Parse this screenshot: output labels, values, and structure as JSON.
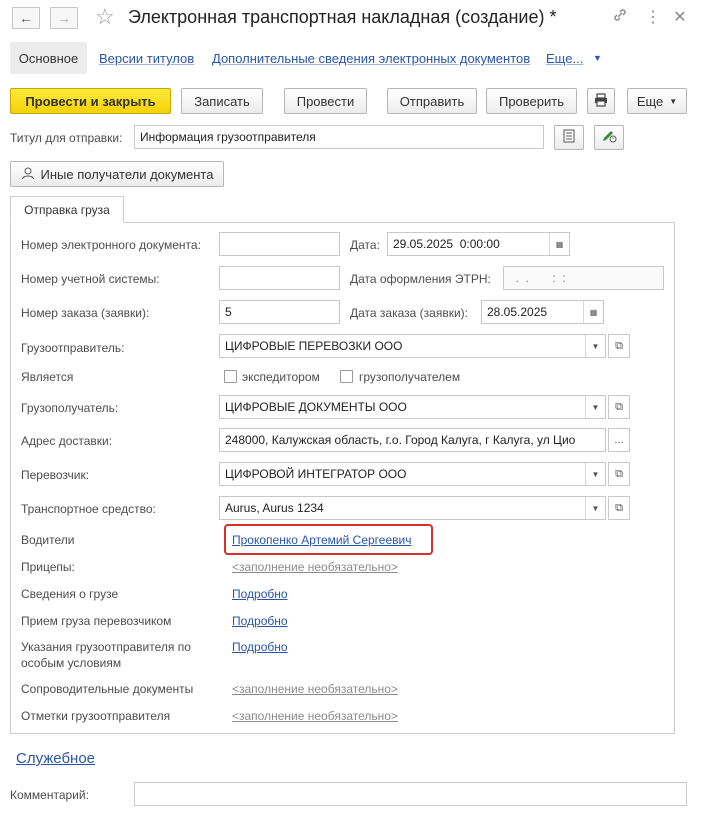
{
  "window": {
    "title": "Электронная транспортная накладная (создание) *",
    "back_icon": "arrow-left-icon",
    "forward_icon": "arrow-right-icon",
    "favorite_icon": "star-icon",
    "link_icon": "link-icon",
    "more_icon": "vertical-dots-icon",
    "close_icon": "close-icon"
  },
  "tabs": [
    {
      "label": "Основное",
      "active": true
    },
    {
      "label": "Версии титулов"
    },
    {
      "label": "Дополнительные сведения электронных документов"
    },
    {
      "label": "Еще..."
    }
  ],
  "toolbar": {
    "post_close": "Провести и закрыть",
    "write": "Записать",
    "post": "Провести",
    "send": "Отправить",
    "check": "Проверить",
    "print_icon": "printer-icon",
    "more": "Еще"
  },
  "title_send": {
    "label": "Титул для отправки:",
    "value": "Информация грузоотправителя"
  },
  "other_recipients": "Иные получатели документа",
  "group_tab": "Отправка груза",
  "form": {
    "doc_number_label": "Номер электронного документа:",
    "doc_number_value": "",
    "date_label": "Дата:",
    "date_value": "29.05.2025  0:00:00",
    "account_number_label": "Номер учетной системы:",
    "account_number_value": "",
    "etrn_date_label": "Дата оформления ЭТРН:",
    "etrn_date_value": "  .  .       :  :",
    "order_number_label": "Номер заказа (заявки):",
    "order_number_value": "5",
    "order_date_label": "Дата заказа (заявки):",
    "order_date_value": "28.05.2025",
    "shipper_label": "Грузоотправитель:",
    "shipper_value": "ЦИФРОВЫЕ ПЕРЕВОЗКИ ООО",
    "is_label": "Является",
    "forwarder_label": "экспедитором",
    "consignee_cb_label": "грузополучателем",
    "consignee_label": "Грузополучатель:",
    "consignee_value": "ЦИФРОВЫЕ ДОКУМЕНТЫ ООО",
    "address_label": "Адрес доставки:",
    "address_value": "248000, Калужская область, г.о. Город Калуга, г Калуга, ул Цио",
    "carrier_label": "Перевозчик:",
    "carrier_value": "ЦИФРОВОЙ ИНТЕГРАТОР ООО",
    "vehicle_label": "Транспортное средство:",
    "vehicle_value": "Aurus, Aurus 1234",
    "drivers_label": "Водители",
    "drivers_value": "Прокопенко Артемий Сергеевич",
    "trailers_label": "Прицепы:",
    "trailers_value": "<заполнение необязательно>",
    "cargo_label": "Сведения о грузе",
    "cargo_value": "Подробно",
    "receipt_label": "Прием груза перевозчиком",
    "receipt_value": "Подробно",
    "instructions_label_1": "Указания грузоотправителя по",
    "instructions_label_2": "особым условиям",
    "instructions_value": "Подробно",
    "accompanying_label": "Сопроводительные документы",
    "accompanying_value": "<заполнение необязательно>",
    "marks_label": "Отметки грузоотправителя",
    "marks_value": "<заполнение необязательно>"
  },
  "service_link": "Служебное",
  "comment": {
    "label": "Комментарий:",
    "value": ""
  }
}
